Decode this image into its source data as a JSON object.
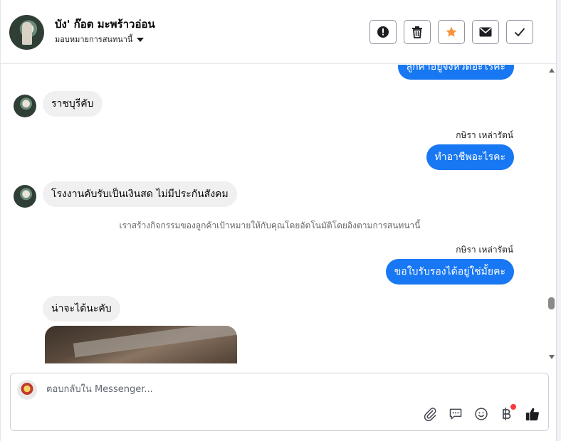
{
  "header": {
    "contact_name": "บัง' ก๊อต มะพร้าวอ่อน",
    "assign_label": "มอบหมายการสนทนานี้",
    "buttons": [
      {
        "name": "report-spam-button",
        "icon": "alert-circle-icon"
      },
      {
        "name": "delete-button",
        "icon": "trash-icon"
      },
      {
        "name": "star-button",
        "icon": "star-icon"
      },
      {
        "name": "mark-unread-button",
        "icon": "envelope-icon"
      },
      {
        "name": "mark-done-button",
        "icon": "checkmark-icon"
      }
    ]
  },
  "messages": {
    "m0": "ลูกค้าอยู่จังหวัดอะไรคะ",
    "m1": "ราชบุรีคับ",
    "m2_sender": "กษิรา เหล่ารัตน์",
    "m2": "ทำอาชีพอะไรคะ",
    "m3": "โรงงานคับรับเป็นเงินสด ไม่มีประกันสังคม",
    "notice": "เราสร้างกิจกรรมของลูกค้าเป้าหมายให้กับคุณโดยอัตโนมัติโดยอิงตามการสนทนานี้",
    "m4_sender": "กษิรา เหล่ารัตน์",
    "m4": "ขอใบรับรองได้อยู่ใช่มั้ยคะ",
    "m5": "น่าจะได้นะคับ"
  },
  "composer": {
    "placeholder": "ตอบกลับใน Messenger..."
  },
  "colors": {
    "outgoing_bubble": "#1877f2",
    "incoming_bubble": "#f0f0f0",
    "star": "#f7923a",
    "notification_dot": "#fa383e"
  }
}
